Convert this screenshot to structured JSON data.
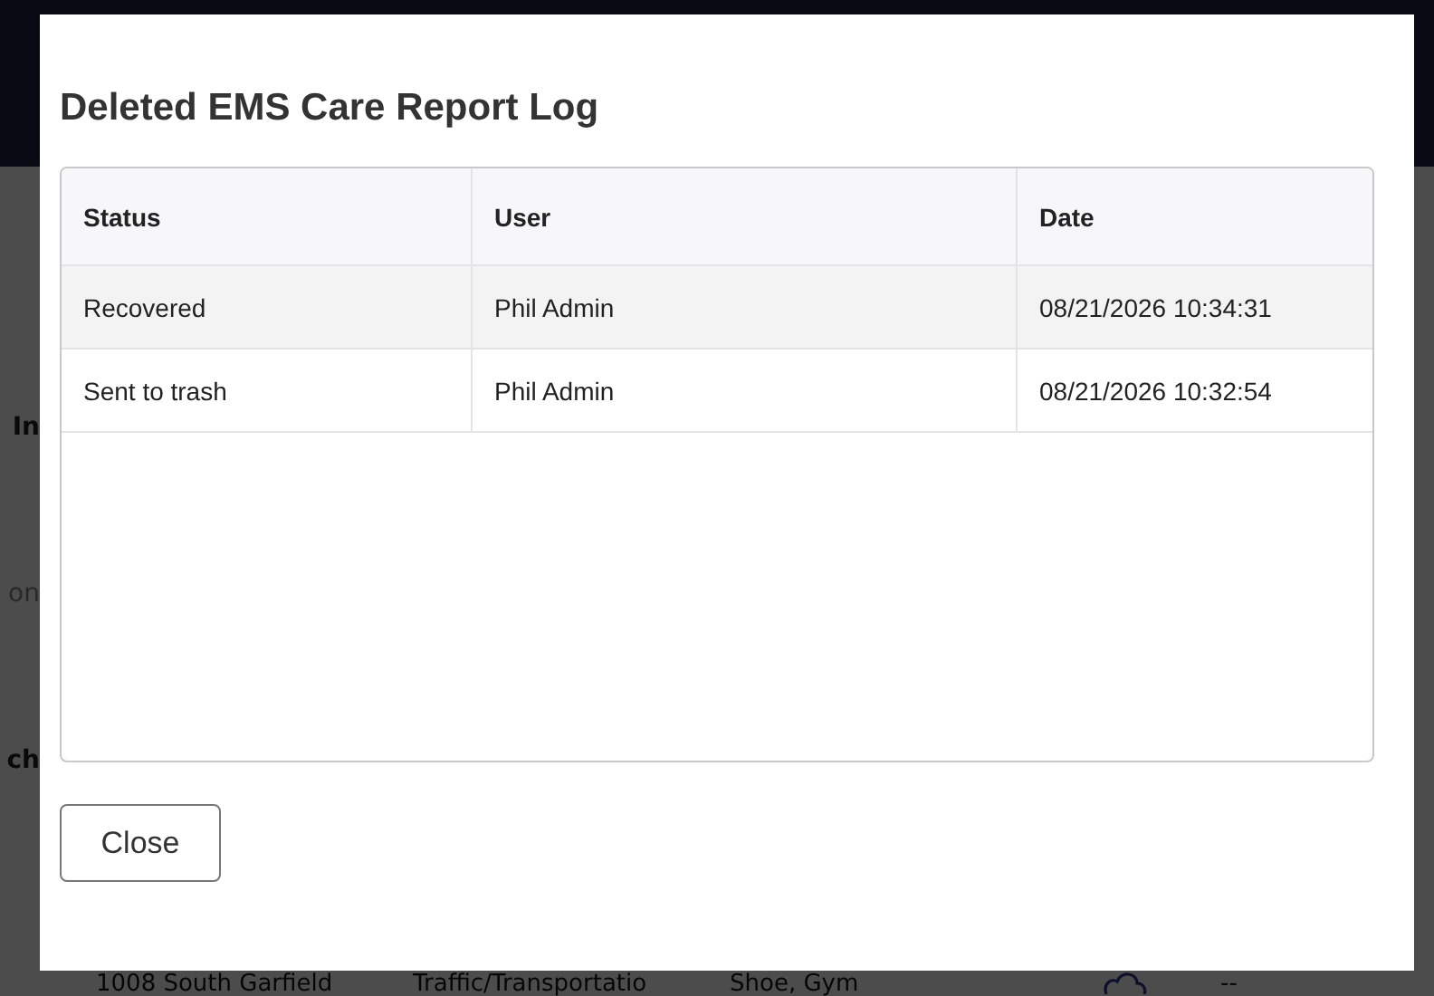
{
  "background": {
    "side_texts": [
      {
        "text": "In",
        "muted": false
      },
      {
        "text": "on",
        "muted": true
      },
      {
        "text": "ch",
        "muted": false
      }
    ],
    "row": [
      "1008 South Garfield",
      "Traffic/Transportatio",
      "Shoe, Gym",
      "--"
    ]
  },
  "dialog": {
    "title": "Deleted EMS Care Report Log",
    "table": {
      "columns": [
        "Status",
        "User",
        "Date"
      ],
      "rows": [
        {
          "cells": [
            "Recovered",
            "Phil Admin",
            "08/21/2026 10:34:31"
          ],
          "selected": true
        },
        {
          "cells": [
            "Sent to trash",
            "Phil Admin",
            "08/21/2026 10:32:54"
          ],
          "selected": false
        }
      ]
    },
    "buttons": [
      "Close"
    ]
  }
}
